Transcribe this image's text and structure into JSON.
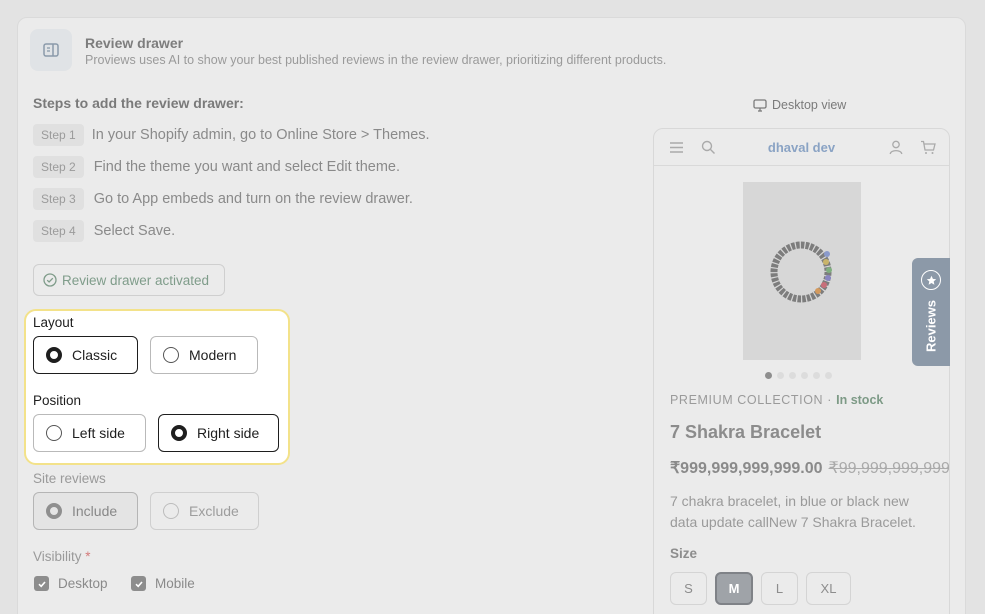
{
  "header": {
    "title": "Review drawer",
    "subtitle": "Proviews uses AI to show your best published reviews in the review drawer, prioritizing different products."
  },
  "steps": {
    "title": "Steps to add the review drawer:",
    "items": [
      {
        "badge": "Step 1",
        "text": "In your Shopify admin, go to Online Store > Themes."
      },
      {
        "badge": "Step 2",
        "text": "Find the theme you want and select Edit theme."
      },
      {
        "badge": "Step 3",
        "text": "Go to App embeds and turn on the review drawer."
      },
      {
        "badge": "Step 4",
        "text": "Select Save."
      }
    ]
  },
  "activated_label": "Review drawer activated",
  "layout": {
    "label": "Layout",
    "options": [
      "Classic",
      "Modern"
    ],
    "selected": "Classic"
  },
  "position": {
    "label": "Position",
    "options": [
      "Left side",
      "Right side"
    ],
    "selected": "Right side"
  },
  "site_reviews": {
    "label": "Site reviews",
    "options": [
      "Include",
      "Exclude"
    ],
    "selected": "Include"
  },
  "visibility": {
    "label": "Visibility",
    "required_mark": "*",
    "options": [
      {
        "label": "Desktop",
        "checked": true
      },
      {
        "label": "Mobile",
        "checked": true
      }
    ]
  },
  "preview": {
    "view_label": "Desktop view",
    "store_name": "dhaval dev",
    "collection": "PREMIUM COLLECTION",
    "separator": "·",
    "stock": "In stock",
    "product_name": "7 Shakra Bracelet",
    "price": "₹999,999,999,999.00",
    "compare_price": "₹99,999,999,999.00",
    "description": "7 chakra bracelet, in blue or black new data update callNew 7 Shakra Bracelet.",
    "size_label": "Size",
    "sizes": [
      "S",
      "M",
      "L",
      "XL"
    ],
    "selected_size": "M",
    "image_count": 6,
    "active_image": 1
  },
  "reviews_tab_label": "Reviews",
  "colors": {
    "accent": "#8c99a8",
    "highlight_border": "#f3e28a",
    "success": "#7f9c8a"
  }
}
